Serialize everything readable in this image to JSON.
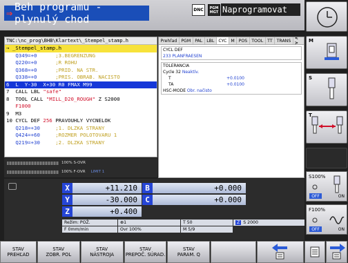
{
  "header": {
    "mode_title": "Beh programu - plynulý chod",
    "dnc_label": "DNC",
    "pgm_label": [
      "PGM",
      "MGT"
    ],
    "prog_mode": "Naprogramovat"
  },
  "program": {
    "path": "TNC:\\nc_prog\\BHB\\Klartext\\_Stempel_stamp.h",
    "lines": [
      {
        "cls": "hdr",
        "parts": [
          {
            "t": "→ _Stempel_stamp.h",
            "c": ""
          }
        ]
      },
      {
        "cls": "",
        "parts": [
          {
            "t": "   Q349=+0",
            "c": "v"
          },
          {
            "t": "      ;3.BEGRENZUNG",
            "c": "c"
          }
        ]
      },
      {
        "cls": "",
        "parts": [
          {
            "t": "   Q220=+0",
            "c": "v"
          },
          {
            "t": "      ;R ROHU",
            "c": "c"
          }
        ]
      },
      {
        "cls": "",
        "parts": [
          {
            "t": "   Q368=+0",
            "c": "v"
          },
          {
            "t": "      ;PRID. NA STR.",
            "c": "c"
          }
        ]
      },
      {
        "cls": "",
        "parts": [
          {
            "t": "   Q338=+0",
            "c": "v"
          },
          {
            "t": "      ;PRIS. OBRAB. NACISTO",
            "c": "c"
          }
        ]
      },
      {
        "cls": "sel",
        "parts": [
          {
            "t": "6  L  Y-30  X+30 R0 FMAX M99",
            "c": ""
          }
        ]
      },
      {
        "cls": "",
        "parts": [
          {
            "t": "7  CALL LBL ",
            "c": ""
          },
          {
            "t": "\"safe\"",
            "c": "r"
          }
        ]
      },
      {
        "cls": "",
        "parts": [
          {
            "t": "8  TOOL CALL ",
            "c": ""
          },
          {
            "t": "\"MILL_D20_ROUGH\"",
            "c": "r"
          },
          {
            "t": " Z S2000",
            "c": ""
          }
        ]
      },
      {
        "cls": "",
        "parts": [
          {
            "t": "   F1000",
            "c": "r"
          }
        ]
      },
      {
        "cls": "",
        "parts": [
          {
            "t": "9  M3",
            "c": ""
          }
        ]
      },
      {
        "cls": "",
        "parts": [
          {
            "t": "10 CYCL DEF ",
            "c": ""
          },
          {
            "t": "256",
            "c": "r"
          },
          {
            "t": " PRAVOUHLY VYCNELOK",
            "c": ""
          }
        ]
      },
      {
        "cls": "",
        "parts": [
          {
            "t": "   Q218=+30",
            "c": "v"
          },
          {
            "t": "     ;1. DLZKA STRANY",
            "c": "c"
          }
        ]
      },
      {
        "cls": "",
        "parts": [
          {
            "t": "   Q424=+60",
            "c": "v"
          },
          {
            "t": "     ;ROZMER POLOTOVARU 1",
            "c": "c"
          }
        ]
      },
      {
        "cls": "",
        "parts": [
          {
            "t": "   Q219=+30",
            "c": "v"
          },
          {
            "t": "     ;2. DLZKA STRANY",
            "c": "c"
          }
        ]
      }
    ]
  },
  "overrides": {
    "spindle": "100% S-OVR",
    "feed": "100% F-OVR",
    "limit": "LIMIT 1"
  },
  "status": {
    "tabs": [
      "Prehľad",
      "PGM",
      "PAL",
      "LBL",
      "CYC",
      "M",
      "POS",
      "TOOL",
      "TT",
      "TRANS"
    ],
    "active_tab": "CYC",
    "tab_arrows": "< >",
    "cycl_def_label": "CYCL DEF",
    "cycl_def_value": "233  PLANFRAESEN",
    "tolerance_label": "TOLERANCIA",
    "cycle32_label": "Cycle 32",
    "cycle32_value": "Neaktív.",
    "t_label": "T",
    "t_value": "+0.0100",
    "ta_label": "TA",
    "ta_value": "+0.0100",
    "hsc_label": "HSC-MODE",
    "hsc_value": "Obr. načisto"
  },
  "positions": {
    "axes": [
      {
        "label": "X",
        "value": "+11.210"
      },
      {
        "label": "Y",
        "value": "-30.000"
      },
      {
        "label": "Z",
        "value": "+0.400"
      }
    ],
    "axes2": [
      {
        "label": "B",
        "value": "+0.000"
      },
      {
        "label": "C",
        "value": "+0.000"
      }
    ],
    "rezim_label": "Režim: POŽ.",
    "icon_1": "⊕1",
    "tool": "T 50",
    "spindle_label": "Z",
    "spindle_speed": "S 2000",
    "feed": "F  0mm/min",
    "ovr": "Ovr 100%",
    "m_state": "M 5/9"
  },
  "softkeys": [
    {
      "l1": "STAV",
      "l2": "PREHĽAD"
    },
    {
      "l1": "STAV",
      "l2": "ZOBR. POL"
    },
    {
      "l1": "STAV",
      "l2": "NÁSTROJA"
    },
    {
      "l1": "STAV",
      "l2": "PREPOČ. SÚRAD."
    },
    {
      "l1": "STAV",
      "l2": "PARAM. Q"
    }
  ],
  "right_panel": {
    "m_label": "M",
    "s_label": "S",
    "t_label": "T",
    "s_override": "S100%",
    "s_off": "OFF",
    "s_on": "ON",
    "f_override": "F100%",
    "f_off": "OFF",
    "f_on": "ON"
  }
}
